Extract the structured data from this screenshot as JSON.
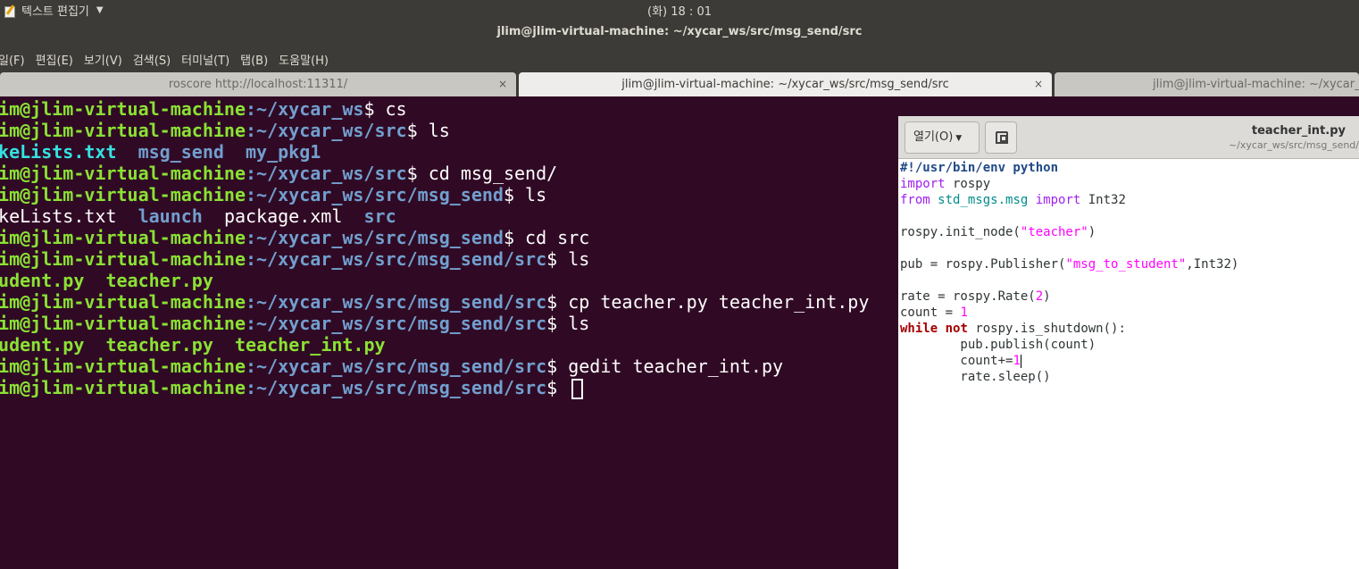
{
  "panel": {
    "app_name": "텍스트 편집기",
    "clock": "(화) 18 : 01"
  },
  "window": {
    "title": "jlim@jlim-virtual-machine: ~/xycar_ws/src/msg_send/src"
  },
  "menubar": {
    "items": [
      "일(F)",
      "편집(E)",
      "보기(V)",
      "검색(S)",
      "터미널(T)",
      "탭(B)",
      "도움말(H)"
    ]
  },
  "tabs": [
    {
      "label": "roscore http://localhost:11311/",
      "close": "×"
    },
    {
      "label": "jlim@jlim-virtual-machine: ~/xycar_ws/src/msg_send/src",
      "close": "×"
    },
    {
      "label": "jlim@jlim-virtual-machine: ~/xycar_ws/",
      "close": "×"
    }
  ],
  "terminal": {
    "user": "lim@jlim-virtual-machine",
    "lines": [
      {
        "path": ":~/xycar_ws",
        "cmd": "$ cs"
      },
      {
        "path": ":~/xycar_ws/src",
        "cmd": "$ ls"
      },
      {
        "out": [
          "akeLists.txt",
          "msg_send",
          "my_pkg1"
        ]
      },
      {
        "path": ":~/xycar_ws/src",
        "cmd": "$ cd msg_send/"
      },
      {
        "path": ":~/xycar_ws/src/msg_send",
        "cmd": "$ ls"
      },
      {
        "out": [
          "akeLists.txt",
          "launch",
          "package.xml",
          "src"
        ]
      },
      {
        "path": ":~/xycar_ws/src/msg_send",
        "cmd": "$ cd src"
      },
      {
        "path": ":~/xycar_ws/src/msg_send/src",
        "cmd": "$ ls"
      },
      {
        "out": [
          "tudent.py",
          "teacher.py"
        ]
      },
      {
        "path": ":~/xycar_ws/src/msg_send/src",
        "cmd": "$ cp teacher.py teacher_int.py"
      },
      {
        "path": ":~/xycar_ws/src/msg_send/src",
        "cmd": "$ ls"
      },
      {
        "out": [
          "tudent.py",
          "teacher.py",
          "teacher_int.py"
        ]
      },
      {
        "path": ":~/xycar_ws/src/msg_send/src",
        "cmd": "$ gedit teacher_int.py"
      },
      {
        "path": ":~/xycar_ws/src/msg_send/src",
        "cmd": "$ "
      }
    ]
  },
  "gedit": {
    "open_label": "열기(O)",
    "doc_title": "teacher_int.py",
    "doc_path": "~/xycar_ws/src/msg_send/",
    "code": [
      "#!/usr/bin/env python",
      "import rospy",
      "from std_msgs.msg import Int32",
      "",
      "rospy.init_node(\"teacher\")",
      "",
      "pub = rospy.Publisher(\"msg_to_student\",Int32)",
      "",
      "rate = rospy.Rate(2)",
      "count = 1",
      "while not rospy.is_shutdown():",
      "        pub.publish(count)",
      "        count+=1",
      "        rate.sleep()"
    ]
  },
  "colors": {
    "terminal_bg": "#300a24",
    "prompt_user": "#8ae234",
    "prompt_path": "#729fcf",
    "panel_bg": "#3c3b37"
  }
}
